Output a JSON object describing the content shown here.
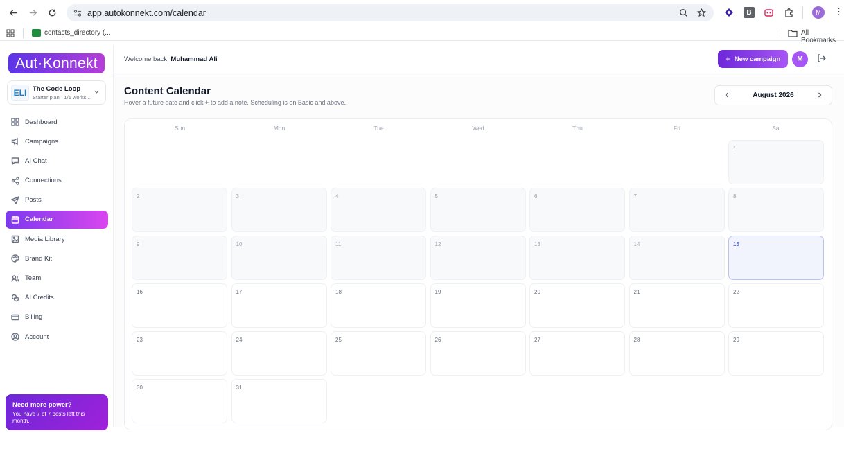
{
  "browser": {
    "url": "app.autokonnekt.com/calendar",
    "bookmark_item": "contacts_directory (...",
    "all_bookmarks": "All Bookmarks",
    "profile_initial": "M"
  },
  "sidebar": {
    "logo": "Aut·Konnekt",
    "workspace": {
      "logo_text": "ELI",
      "name": "The Code Loop",
      "plan": "Starter plan · 1/1 works..."
    },
    "items": [
      {
        "label": "Dashboard",
        "icon": "grid-icon"
      },
      {
        "label": "Campaigns",
        "icon": "megaphone-icon"
      },
      {
        "label": "AI Chat",
        "icon": "chat-icon"
      },
      {
        "label": "Connections",
        "icon": "share-icon"
      },
      {
        "label": "Posts",
        "icon": "send-icon"
      },
      {
        "label": "Calendar",
        "icon": "calendar-icon",
        "active": true
      },
      {
        "label": "Media Library",
        "icon": "image-icon"
      },
      {
        "label": "Brand Kit",
        "icon": "palette-icon"
      },
      {
        "label": "Team",
        "icon": "users-icon"
      },
      {
        "label": "AI Credits",
        "icon": "coins-icon"
      },
      {
        "label": "Billing",
        "icon": "card-icon"
      },
      {
        "label": "Account",
        "icon": "user-circle-icon"
      }
    ],
    "upsell": {
      "title": "Need more power?",
      "text": "You have 7 of 7 posts left this month."
    }
  },
  "topbar": {
    "welcome_prefix": "Welcome back,",
    "user_name": "Muhammad Ali",
    "new_campaign": "New campaign",
    "new_campaign_plus": "+",
    "avatar_initial": "M"
  },
  "calendar": {
    "title": "Content Calendar",
    "subtitle": "Hover a future date and click + to add a note. Scheduling is on Basic and above.",
    "month_label": "August 2026",
    "weekdays": [
      "Sun",
      "Mon",
      "Tue",
      "Wed",
      "Thu",
      "Fri",
      "Sat"
    ],
    "first_weekday_index": 6,
    "days_in_month": 31,
    "today": 15
  },
  "colors": {
    "accent": "#7c3aed",
    "accent_end": "#d946ef"
  }
}
